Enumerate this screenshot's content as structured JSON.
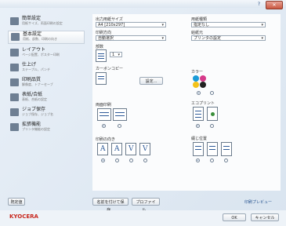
{
  "window": {
    "help": "?",
    "close": "✕"
  },
  "sidebar": {
    "items": [
      {
        "title": "簡単設定",
        "sub": "用紙サイズ、両面印刷の設定"
      },
      {
        "title": "基本設定",
        "sub": "用紙、部数、印刷の向き"
      },
      {
        "title": "レイアウト",
        "sub": "ページ配置、ポスター印刷"
      },
      {
        "title": "仕上げ",
        "sub": "ステープル、パンチ"
      },
      {
        "title": "印刷品質",
        "sub": "解像度、トナーセーブ"
      },
      {
        "title": "表紙/合紙",
        "sub": "表紙、合紙の設定"
      },
      {
        "title": "ジョブ保存",
        "sub": "ジョブ保存、ジョブ名"
      },
      {
        "title": "拡張機能",
        "sub": "プリンタ機能の設定"
      }
    ]
  },
  "main": {
    "paper_size_label": "出力用紙サイズ",
    "paper_size_value": "A4 [210x297]",
    "orientation_label": "印刷方向",
    "orientation_value": "自動選択",
    "copies_label": "部数",
    "copies_value": "1",
    "cover_label": "カーボンコピー",
    "cover_button": "設定...",
    "duplex_label": "両面印刷",
    "nup_label": "印刷の向き",
    "source_label": "用紙種類",
    "source_value": "指定なし",
    "source2_label": "給紙元",
    "source2_value": "プリンタの設定",
    "color_label": "カラー",
    "ecoprint_label": "エコプリント",
    "staple_label": "綴じ位置",
    "orient_icons": [
      "A",
      "A",
      "V",
      "V"
    ]
  },
  "bottom": {
    "reset_button": "既定値",
    "save_button": "名前を付けて保存...",
    "profile_button": "プロファイル...",
    "preview_link": "印刷プレビュー",
    "ok_button": "OK",
    "cancel_button": "キャンセル"
  },
  "brand": {
    "logo": "KYOCERA"
  }
}
